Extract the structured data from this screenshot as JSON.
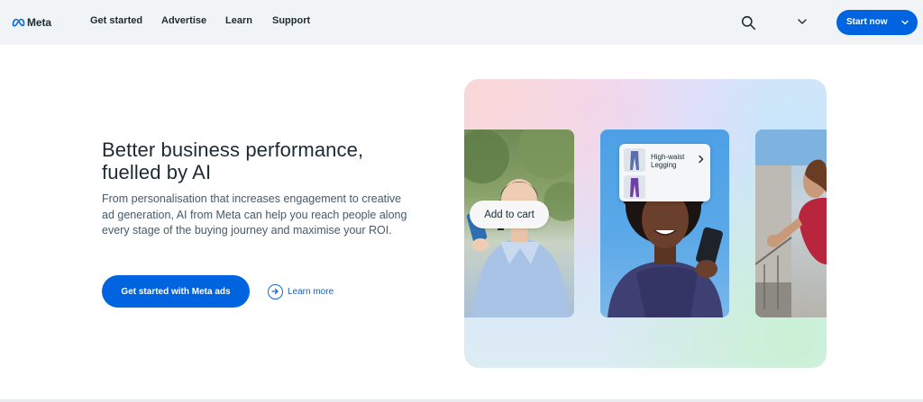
{
  "nav": {
    "logo_text": "Meta",
    "links": [
      "Get started",
      "Advertise",
      "Learn",
      "Support"
    ],
    "start_now_label": "Start now"
  },
  "hero": {
    "headline_line1": "Better business performance,",
    "headline_line2": "fuelled by AI",
    "body": "From personalisation that increases engagement to creative ad generation, AI from Meta can help you reach people along every stage of the buying journey and maximise your ROI.",
    "cta_label": "Get started with Meta ads",
    "learn_more_label": "Learn more"
  },
  "visual": {
    "add_to_cart_label": "Add to cart",
    "product_line1": "High-waist",
    "product_line2": "Legging"
  },
  "colors": {
    "brand_blue": "#0064e0",
    "nav_bg": "#f1f4f7",
    "text_primary": "#1c2b33",
    "text_secondary": "#465a69"
  },
  "icons": [
    "meta-logo-icon",
    "search-icon",
    "chevron-down-icon",
    "arrow-right-circle-icon",
    "chevron-right-icon"
  ]
}
